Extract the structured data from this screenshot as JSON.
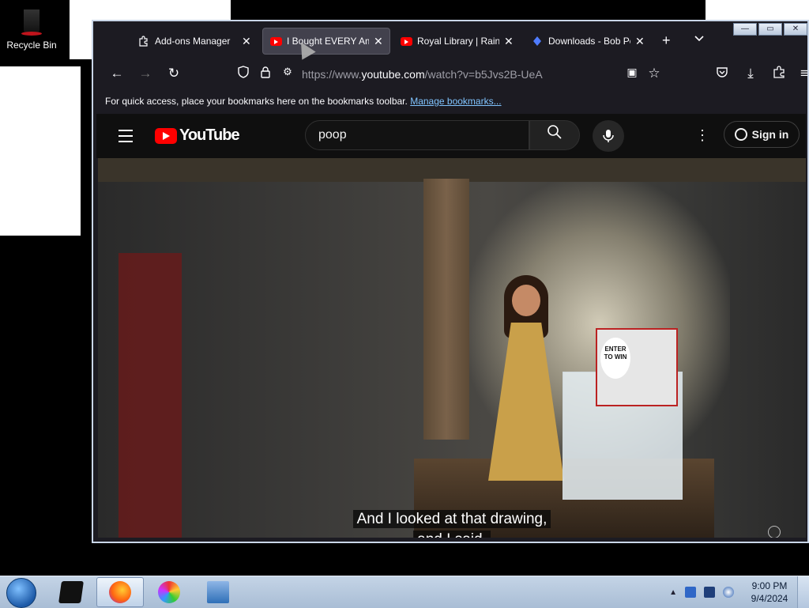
{
  "desktop": {
    "recycle_bin_label": "Recycle Bin"
  },
  "browser": {
    "tabs": [
      {
        "label": "Add-ons Manager",
        "icon": "puzzle-icon",
        "active": false
      },
      {
        "label": "I Bought EVERY Am",
        "icon": "youtube-icon",
        "active": true
      },
      {
        "label": "Royal Library | Rain",
        "icon": "youtube-icon",
        "active": false
      },
      {
        "label": "Downloads - Bob Po",
        "icon": "download-icon",
        "active": false
      }
    ],
    "new_tab": "+",
    "tab_list": "⌄",
    "url_prefix": "https://www.",
    "url_domain": "youtube.com",
    "url_path": "/watch?v=b5Jvs2B-UeA",
    "bookmarks_hint": "For quick access, place your bookmarks here on the bookmarks toolbar.",
    "bookmarks_link": "Manage bookmarks..."
  },
  "youtube": {
    "logo_text": "YouTube",
    "search_value": "poop",
    "sign_in_label": "Sign in"
  },
  "video": {
    "caption_line1": "And I looked at that drawing,",
    "caption_line2": "and I said,",
    "poster_text": "ENTER TO WIN"
  },
  "taskbar": {
    "time": "9:00 PM",
    "date": "9/4/2024"
  },
  "colors": {
    "youtube_red": "#ff0000",
    "browser_bg": "#1c1b22",
    "link": "#80c4ff"
  }
}
